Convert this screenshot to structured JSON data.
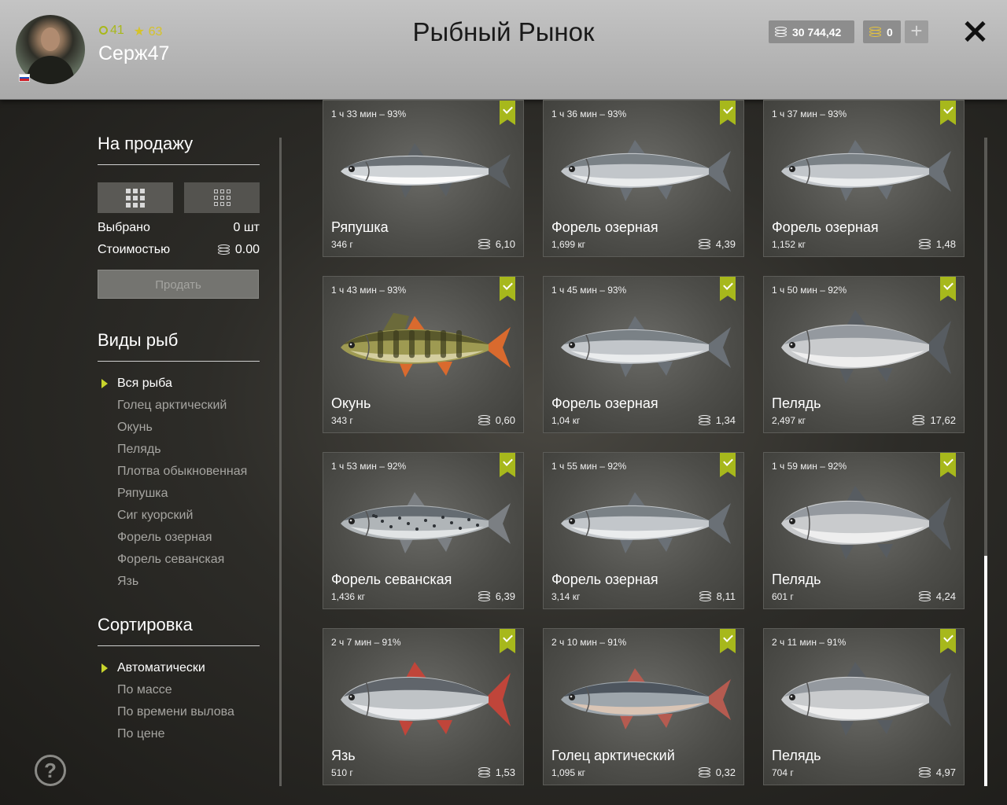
{
  "header": {
    "title": "Рыбный Рынок",
    "username": "Серж47",
    "level": "41",
    "rank": "63",
    "silver": "30 744,42",
    "gold": "0",
    "plus": "+",
    "flag_colors": [
      "#ffffff",
      "#1c4fbf",
      "#d0202a"
    ]
  },
  "sidebar": {
    "for_sale_title": "На продажу",
    "selected_label": "Выбрано",
    "selected_value": "0 шт",
    "cost_label": "Стоимостью",
    "cost_value": "0.00",
    "sell_button": "Продать",
    "species_title": "Виды рыб",
    "species": [
      "Вся рыба",
      "Голец арктический",
      "Окунь",
      "Пелядь",
      "Плотва обыкновенная",
      "Ряпушка",
      "Сиг куорский",
      "Форель озерная",
      "Форель севанская",
      "Язь"
    ],
    "sort_title": "Сортировка",
    "sort_options": [
      "Автоматически",
      "По массе",
      "По времени вылова",
      "По цене"
    ]
  },
  "help": "?",
  "accent_color": "#a7b81c",
  "scroll_position": 0.65,
  "cards": [
    {
      "time": "1 ч 33 мин – 93%",
      "name": "Ряпушка",
      "weight": "346 г",
      "price": "6,10",
      "fish": "vendace"
    },
    {
      "time": "1 ч 36 мин – 93%",
      "name": "Форель озерная",
      "weight": "1,699 кг",
      "price": "4,39",
      "fish": "trout"
    },
    {
      "time": "1 ч 37 мин – 93%",
      "name": "Форель озерная",
      "weight": "1,152 кг",
      "price": "1,48",
      "fish": "trout"
    },
    {
      "time": "1 ч 43 мин – 93%",
      "name": "Окунь",
      "weight": "343 г",
      "price": "0,60",
      "fish": "perch"
    },
    {
      "time": "1 ч 45 мин – 93%",
      "name": "Форель озерная",
      "weight": "1,04 кг",
      "price": "1,34",
      "fish": "trout"
    },
    {
      "time": "1 ч 50 мин – 92%",
      "name": "Пелядь",
      "weight": "2,497 кг",
      "price": "17,62",
      "fish": "peled"
    },
    {
      "time": "1 ч 53 мин – 92%",
      "name": "Форель севанская",
      "weight": "1,436 кг",
      "price": "6,39",
      "fish": "sevan-trout"
    },
    {
      "time": "1 ч 55 мин – 92%",
      "name": "Форель озерная",
      "weight": "3,14 кг",
      "price": "8,11",
      "fish": "trout"
    },
    {
      "time": "1 ч 59 мин – 92%",
      "name": "Пелядь",
      "weight": "601 г",
      "price": "4,24",
      "fish": "peled"
    },
    {
      "time": "2 ч 7 мин – 91%",
      "name": "Язь",
      "weight": "510 г",
      "price": "1,53",
      "fish": "ide"
    },
    {
      "time": "2 ч 10 мин – 91%",
      "name": "Голец арктический",
      "weight": "1,095 кг",
      "price": "0,32",
      "fish": "char"
    },
    {
      "time": "2 ч 11 мин – 91%",
      "name": "Пелядь",
      "weight": "704 г",
      "price": "4,97",
      "fish": "peled"
    }
  ]
}
